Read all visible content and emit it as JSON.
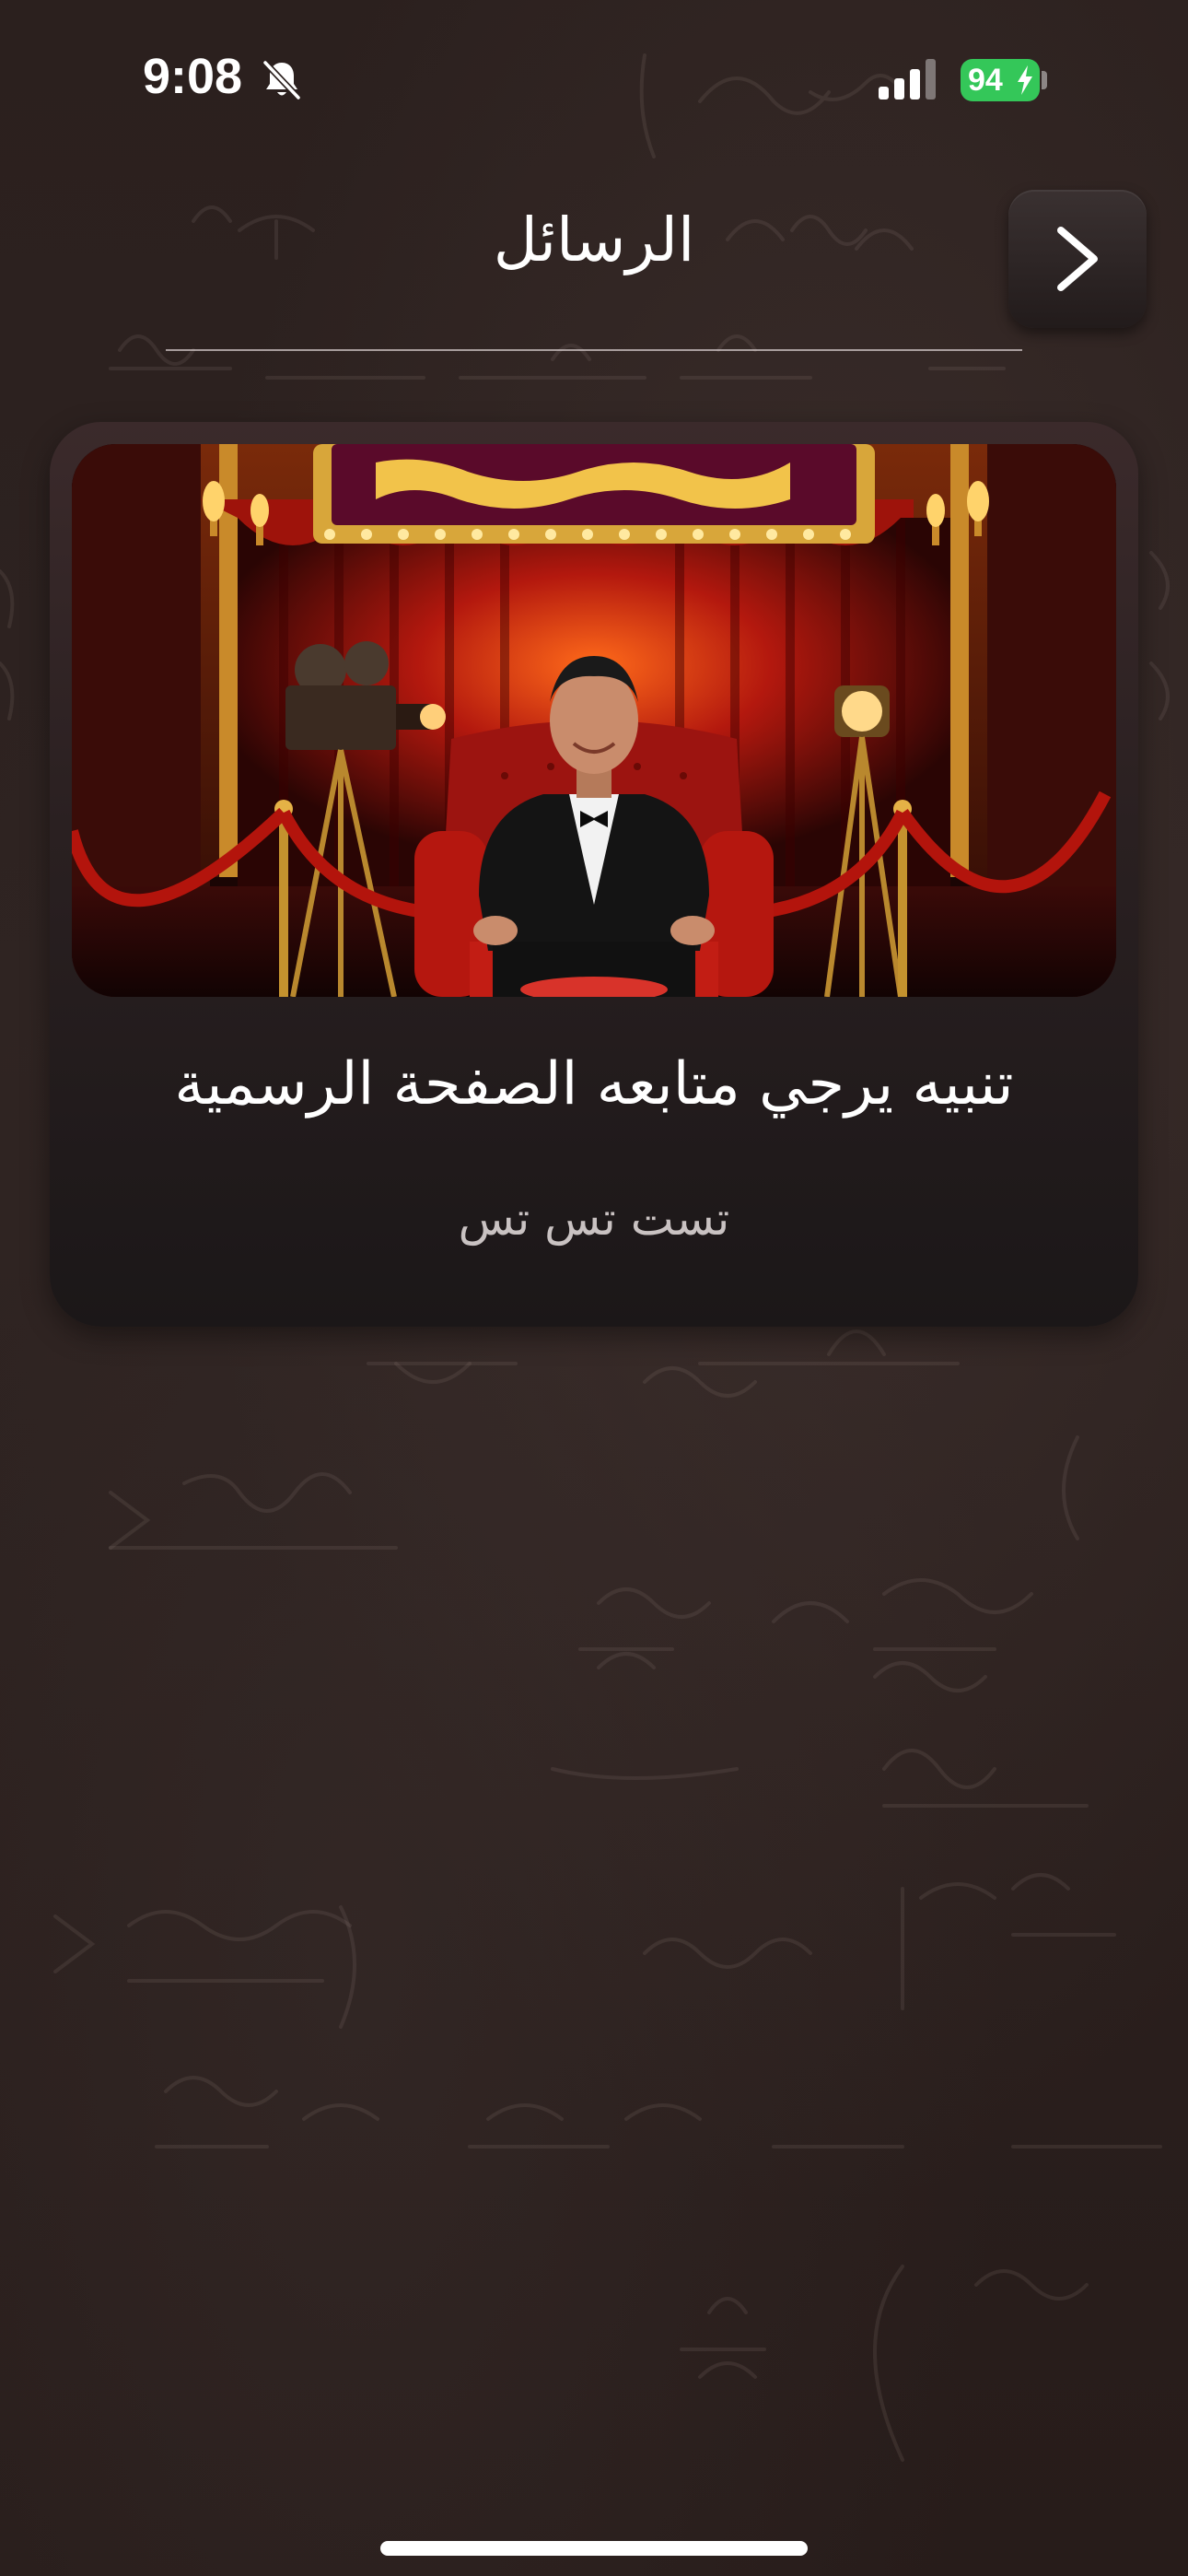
{
  "status_bar": {
    "time": "9:08",
    "battery_level": "94",
    "icons": [
      "silent-mode-icon",
      "cellular-signal-icon",
      "battery-charging-icon"
    ],
    "battery_color": "#34c759"
  },
  "header": {
    "title": "الرسائل",
    "back_icon": "chevron-right-icon"
  },
  "messages": [
    {
      "title": "تنبيه يرجي متابعه الصفحة الرسمية",
      "body": "تست تس تس",
      "image": "stage-photo"
    }
  ],
  "colors": {
    "background": "#2a1f1d",
    "card": "#2a2021",
    "accent_red": "#c21d14"
  }
}
